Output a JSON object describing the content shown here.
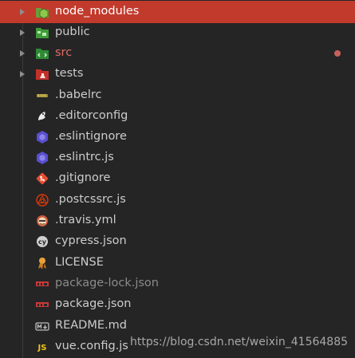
{
  "explorer": {
    "items": [
      {
        "label": "node_modules",
        "type": "folder",
        "icon": "folder-node-icon",
        "selected": true
      },
      {
        "label": "public",
        "type": "folder",
        "icon": "folder-public-icon"
      },
      {
        "label": "src",
        "type": "folder",
        "icon": "folder-src-icon",
        "status": "modified"
      },
      {
        "label": "tests",
        "type": "folder",
        "icon": "folder-tests-icon"
      },
      {
        "label": ".babelrc",
        "type": "file",
        "icon": "babel-icon"
      },
      {
        "label": ".editorconfig",
        "type": "file",
        "icon": "editorconfig-icon"
      },
      {
        "label": ".eslintignore",
        "type": "file",
        "icon": "eslint-icon"
      },
      {
        "label": ".eslintrc.js",
        "type": "file",
        "icon": "eslint-icon"
      },
      {
        "label": ".gitignore",
        "type": "file",
        "icon": "git-icon"
      },
      {
        "label": ".postcssrc.js",
        "type": "file",
        "icon": "postcss-icon"
      },
      {
        "label": ".travis.yml",
        "type": "file",
        "icon": "travis-icon"
      },
      {
        "label": "cypress.json",
        "type": "file",
        "icon": "cypress-icon"
      },
      {
        "label": "LICENSE",
        "type": "file",
        "icon": "license-icon"
      },
      {
        "label": "package-lock.json",
        "type": "file",
        "icon": "npm-icon",
        "status": "ignored"
      },
      {
        "label": "package.json",
        "type": "file",
        "icon": "npm-icon"
      },
      {
        "label": "README.md",
        "type": "file",
        "icon": "markdown-icon"
      },
      {
        "label": "vue.config.js",
        "type": "file",
        "icon": "js-icon"
      }
    ]
  },
  "watermark": {
    "text": "https://blog.csdn.net/weixin_41564885"
  },
  "colors": {
    "selection": "#c23a2c",
    "modified": "#e06c65",
    "ignored": "#8b8b8b",
    "background": "#252526"
  }
}
